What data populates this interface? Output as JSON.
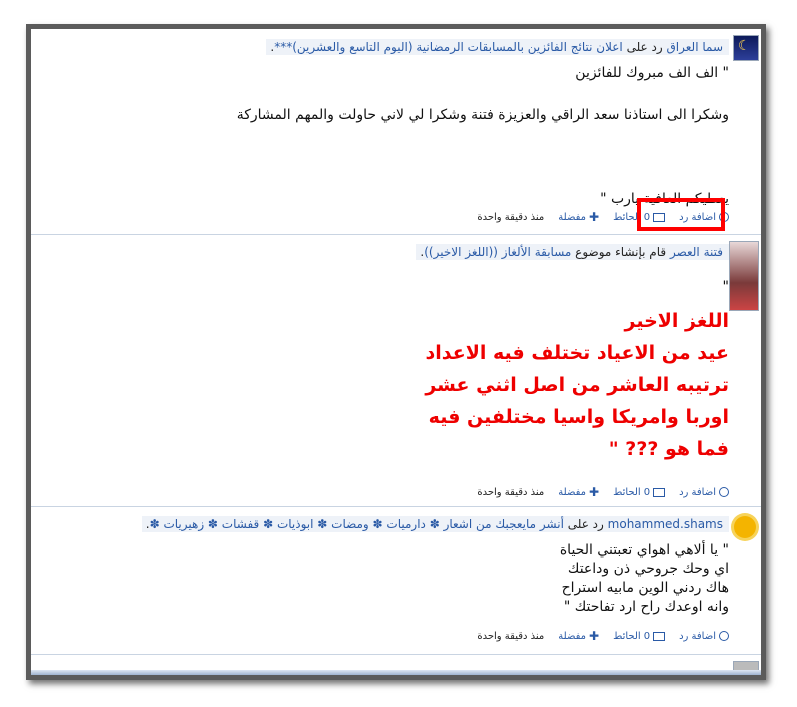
{
  "posts": [
    {
      "author": "سما العراق",
      "action": "رد على",
      "topic": "اعلان نتائج الفائزين بالمسابقات الرمضانية (اليوم التاسع والعشرين)***",
      "body": "\" الف الف مبروك للفائزين\n\nوشكرا الى استاذنا سعد الراقي والعزيزة فتنة وشكرا لي لاني حاولت والمهم المشاركة\n\n\n\nيعطيكم العافية يارب \""
    },
    {
      "author": "فتنة العصر",
      "action": "قام بإنشاء موضوع",
      "topic": "مسابقة الألغاز ((اللغز الاخير))",
      "quote_open": "\"",
      "body": "اللغز الاخير\nعيد من الاعياد تختلف فيه الاعداد\nترتيبه العاشر من اصل اثني عشر\nاوربا وامريكا واسيا مختلفين فيه\nفما هو ??? \""
    },
    {
      "author": "mohammed.shams",
      "action": "رد على",
      "topic": "أنشر مايعجبك من اشعار ✽ دارميات ✽ ومضات ✽ ابوذيات ✽ قفشات ✽ زهيريات ✽",
      "body": "\" يا ألاهي اهواي تعبتني الحياة\nاي وحك جروحي ذن وداعتك\nهاك ردني الوين مابيه استراح\nوانه اوعدك راح ارد تفاحتك \""
    }
  ],
  "actions": {
    "reply": "اضافة رد",
    "wall_count": "0",
    "wall": "الحائط",
    "favorite": "مفضلة",
    "time_ago": "منذ دقيقة واحدة"
  },
  "colors": {
    "link": "#2a5aa6",
    "highlight": "#ff0000",
    "riddle": "#ee0000"
  }
}
